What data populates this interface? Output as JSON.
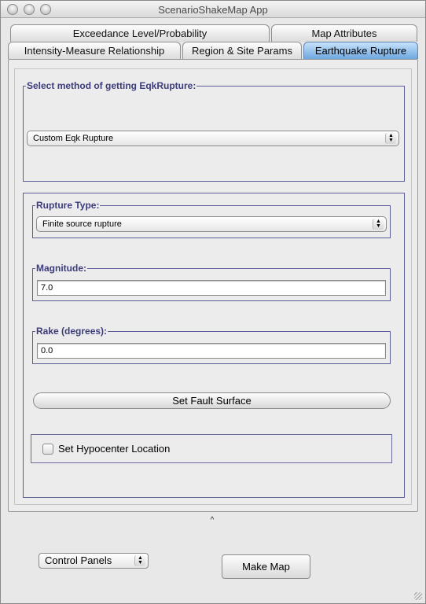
{
  "window": {
    "title": "ScenarioShakeMap App"
  },
  "tabs": {
    "row1": [
      {
        "label": "Exceedance Level/Probability"
      },
      {
        "label": "Map Attributes"
      }
    ],
    "row2": [
      {
        "label": "Intensity-Measure Relationship"
      },
      {
        "label": "Region & Site Params"
      },
      {
        "label": "Earthquake Rupture",
        "active": true
      }
    ]
  },
  "eqk_method": {
    "title": "Select method of getting EqkRupture:",
    "selected": "Custom Eqk Rupture"
  },
  "rupture": {
    "type_label": "Rupture Type:",
    "type_value": "Finite source rupture",
    "magnitude_label": "Magnitude:",
    "magnitude_value": "7.0",
    "rake_label": "Rake (degrees):",
    "rake_value": "0.0",
    "fault_button": "Set Fault Surface",
    "hypocenter_label": "Set Hypocenter Location",
    "hypocenter_checked": false
  },
  "splitter": {
    "glyph": "^"
  },
  "footer": {
    "control_panels": "Control Panels",
    "make_map": "Make Map"
  },
  "icons": {
    "popup_arrows": "up-down-arrows-icon",
    "traffic_lights": [
      "close-icon",
      "minimize-icon",
      "zoom-icon"
    ]
  }
}
